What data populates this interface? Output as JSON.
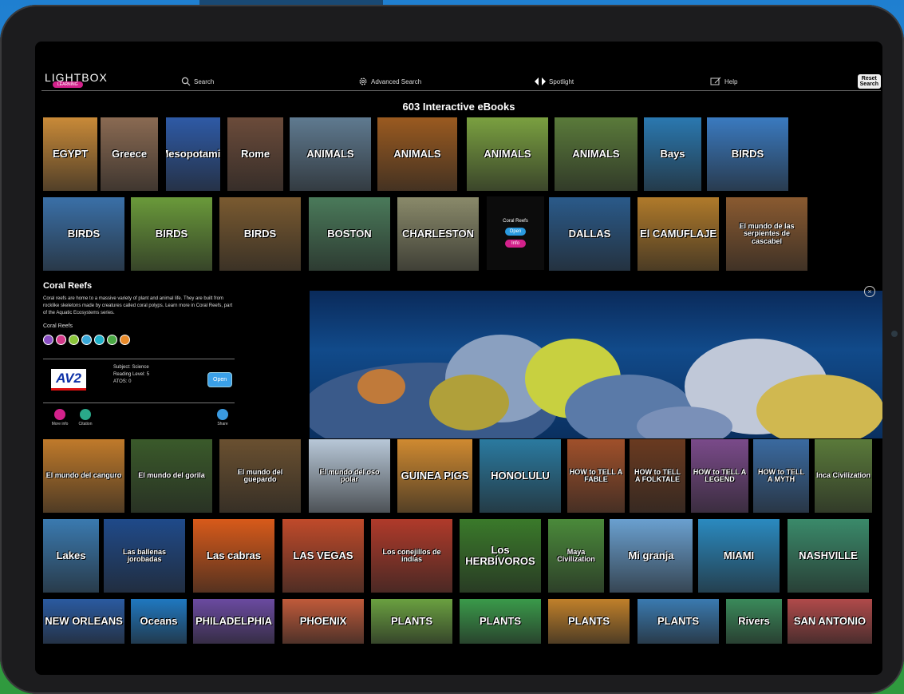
{
  "nav": {
    "logo": "LIGHTBOX",
    "logo_sub": "LEARNING",
    "search": "Search",
    "advanced_search": "Advanced Search",
    "spotlight": "Spotlight",
    "help": "Help",
    "reset_line1": "Reset",
    "reset_line2": "Search"
  },
  "count_label": "603 Interactive eBooks",
  "row1": [
    {
      "title": "EGYPT",
      "bg": "#c98a38"
    },
    {
      "title": "Greece",
      "bg": "#8a6a52"
    },
    {
      "title": "Mesopotamia",
      "bg": "#2e5aa6"
    },
    {
      "title": "Rome",
      "bg": "#6b4b3a"
    },
    {
      "title": "ANIMALS",
      "bg": "#5f7a90"
    },
    {
      "title": "ANIMALS",
      "bg": "#9a5a20"
    },
    {
      "title": "ANIMALS",
      "bg": "#7aa040"
    },
    {
      "title": "ANIMALS",
      "bg": "#5a7a3a"
    },
    {
      "title": "Bays",
      "bg": "#2a78b0"
    },
    {
      "title": "BIRDS",
      "bg": "#3a7ac0"
    }
  ],
  "row2": [
    {
      "title": "BIRDS",
      "bg": "#3a70a8"
    },
    {
      "title": "BIRDS",
      "bg": "#6a9a3a"
    },
    {
      "title": "BIRDS",
      "bg": "#7a5a30"
    },
    {
      "title": "BOSTON",
      "bg": "#4a7a5a"
    },
    {
      "title": "CHARLESTON",
      "bg": "#8a8a6a"
    },
    {
      "title": "DALLAS",
      "bg": "#2a5a8a"
    },
    {
      "title": "El CAMUFLAJE",
      "bg": "#b07a2a"
    },
    {
      "title": "El mundo de las serpientes de cascabel",
      "bg": "#8a5a30"
    }
  ],
  "hover": {
    "title": "Coral Reefs",
    "open": "Open",
    "info": "Info"
  },
  "detail": {
    "title": "Coral Reefs",
    "description": "Coral reefs are home to a massive variety of plant and animal life. They are built from rocklike skeletons made by creatures called coral polyps. Learn more in Coral Reefs, part of the Aquatic Ecosystems series.",
    "series": "Coral Reefs",
    "publisher_logo": "AV2",
    "subject": "Subject:  Science",
    "reading_level": "Reading Level:  5",
    "atos": "ATOS:  0",
    "open": "Open",
    "more_info": "More info",
    "citation": "Citation",
    "share": "Share",
    "dot_colors": [
      "#8a4fc2",
      "#d33a8a",
      "#8ac43a",
      "#3aa8d8",
      "#1fb0c8",
      "#4aa844",
      "#e88a2a"
    ]
  },
  "row3": [
    {
      "title": "El mundo del canguro",
      "bg": "#c07a2a"
    },
    {
      "title": "El mundo del gorila",
      "bg": "#3a5a2a"
    },
    {
      "title": "El mundo del guepardo",
      "bg": "#6a5030"
    },
    {
      "title": "El mundo del oso polar",
      "bg": "#b8c8d8"
    },
    {
      "title": "GUINEA PIGS",
      "bg": "#d08a30"
    },
    {
      "title": "HONOLULU",
      "bg": "#2a7aa0"
    },
    {
      "title": "HOW to TELL A FABLE",
      "bg": "#a0502a"
    },
    {
      "title": "HOW to TELL A FOLKTALE",
      "bg": "#6a3a20"
    },
    {
      "title": "HOW to TELL A LEGEND",
      "bg": "#7a4a8a"
    },
    {
      "title": "HOW to TELL A MYTH",
      "bg": "#3a6aa0"
    },
    {
      "title": "Inca Civilization",
      "bg": "#5a7a3a"
    }
  ],
  "row4": [
    {
      "title": "Lakes",
      "bg": "#3a7ab0"
    },
    {
      "title": "Las ballenas jorobadas",
      "bg": "#1f4a8a"
    },
    {
      "title": "Las cabras",
      "bg": "#d85a1a"
    },
    {
      "title": "LAS VEGAS",
      "bg": "#c04a2a"
    },
    {
      "title": "Los conejillos de indias",
      "bg": "#b03a2a"
    },
    {
      "title": "Los HERBÍVOROS",
      "bg": "#3a7a2a"
    },
    {
      "title": "Maya Civilization",
      "bg": "#4a8a3a"
    },
    {
      "title": "Mi granja",
      "bg": "#6aa0d0"
    },
    {
      "title": "MIAMI",
      "bg": "#2a8ac0"
    },
    {
      "title": "NASHVILLE",
      "bg": "#3a8a6a"
    }
  ],
  "row5": [
    {
      "title": "NEW ORLEANS",
      "bg": "#2a5aa0"
    },
    {
      "title": "Oceans",
      "bg": "#1f78c0"
    },
    {
      "title": "PHILADELPHIA",
      "bg": "#6a4aa0"
    },
    {
      "title": "PHOENIX",
      "bg": "#c05a3a"
    },
    {
      "title": "PLANTS",
      "bg": "#6aa040"
    },
    {
      "title": "PLANTS",
      "bg": "#3a9a4a"
    },
    {
      "title": "PLANTS",
      "bg": "#c0802a"
    },
    {
      "title": "PLANTS",
      "bg": "#3a7ab0"
    },
    {
      "title": "Rivers",
      "bg": "#3a8a5a"
    },
    {
      "title": "SAN ANTONIO",
      "bg": "#b04a4a"
    }
  ]
}
